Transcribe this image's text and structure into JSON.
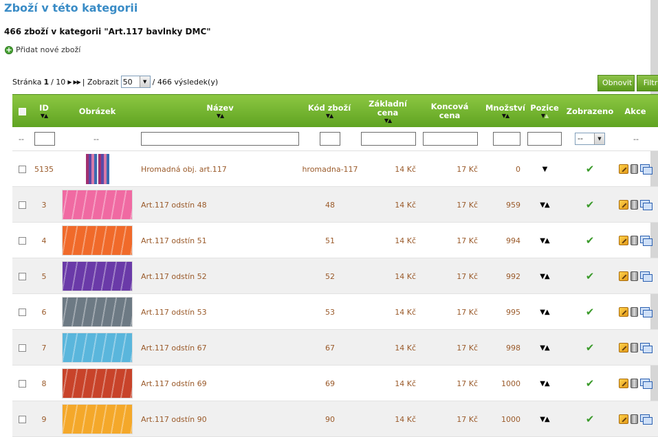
{
  "page": {
    "title": "Zboží v této kategorii",
    "subtitle": "466 zboží v kategorii \"Art.117 bavlnky DMC\"",
    "add_label": "Přidat nové zboží"
  },
  "pager": {
    "page_label": "Stránka",
    "current_page": "1",
    "total_pages": "/ 10",
    "show_label": "| Zobrazit",
    "per_page": "50",
    "results": "/ 466 výsledek(y)"
  },
  "buttons": {
    "refresh": "Obnovit",
    "filter": "Filtr"
  },
  "columns": {
    "id": "ID",
    "image": "Obrázek",
    "name": "Název",
    "code": "Kód zboží",
    "base_price_1": "Základní",
    "base_price_2": "cena",
    "final_price_1": "Koncová",
    "final_price_2": "cena",
    "quantity": "Množství",
    "position": "Pozice",
    "shown": "Zobrazeno",
    "actions": "Akce"
  },
  "filters": {
    "dash": "--",
    "shown_select": "--"
  },
  "rows": [
    {
      "id": "5135",
      "name": "Hromadná obj. art.117",
      "code": "hromadna-117",
      "base": "14 Kč",
      "final": "17 Kč",
      "qty": "0",
      "pos": "▼",
      "image": "mix"
    },
    {
      "id": "3",
      "name": "Art.117 odstín 48",
      "code": "48",
      "base": "14 Kč",
      "final": "17 Kč",
      "qty": "959",
      "pos": "▼▲",
      "image": "#f06aa2"
    },
    {
      "id": "4",
      "name": "Art.117 odstín 51",
      "code": "51",
      "base": "14 Kč",
      "final": "17 Kč",
      "qty": "994",
      "pos": "▼▲",
      "image": "#f06a2a"
    },
    {
      "id": "5",
      "name": "Art.117 odstín 52",
      "code": "52",
      "base": "14 Kč",
      "final": "17 Kč",
      "qty": "992",
      "pos": "▼▲",
      "image": "#6a3aa8"
    },
    {
      "id": "6",
      "name": "Art.117 odstín 53",
      "code": "53",
      "base": "14 Kč",
      "final": "17 Kč",
      "qty": "995",
      "pos": "▼▲",
      "image": "#6d7a84"
    },
    {
      "id": "7",
      "name": "Art.117 odstín 67",
      "code": "67",
      "base": "14 Kč",
      "final": "17 Kč",
      "qty": "998",
      "pos": "▼▲",
      "image": "#5ab6dc"
    },
    {
      "id": "8",
      "name": "Art.117 odstín 69",
      "code": "69",
      "base": "14 Kč",
      "final": "17 Kč",
      "qty": "1000",
      "pos": "▼▲",
      "image": "#c8432a"
    },
    {
      "id": "9",
      "name": "Art.117 odstín 90",
      "code": "90",
      "base": "14 Kč",
      "final": "17 Kč",
      "qty": "1000",
      "pos": "▼▲",
      "image": "#f4a82a"
    }
  ],
  "colors": {
    "title": "#3a8cc6",
    "header_green": "#6eb02a",
    "link_brown": "#9a5a2a"
  }
}
